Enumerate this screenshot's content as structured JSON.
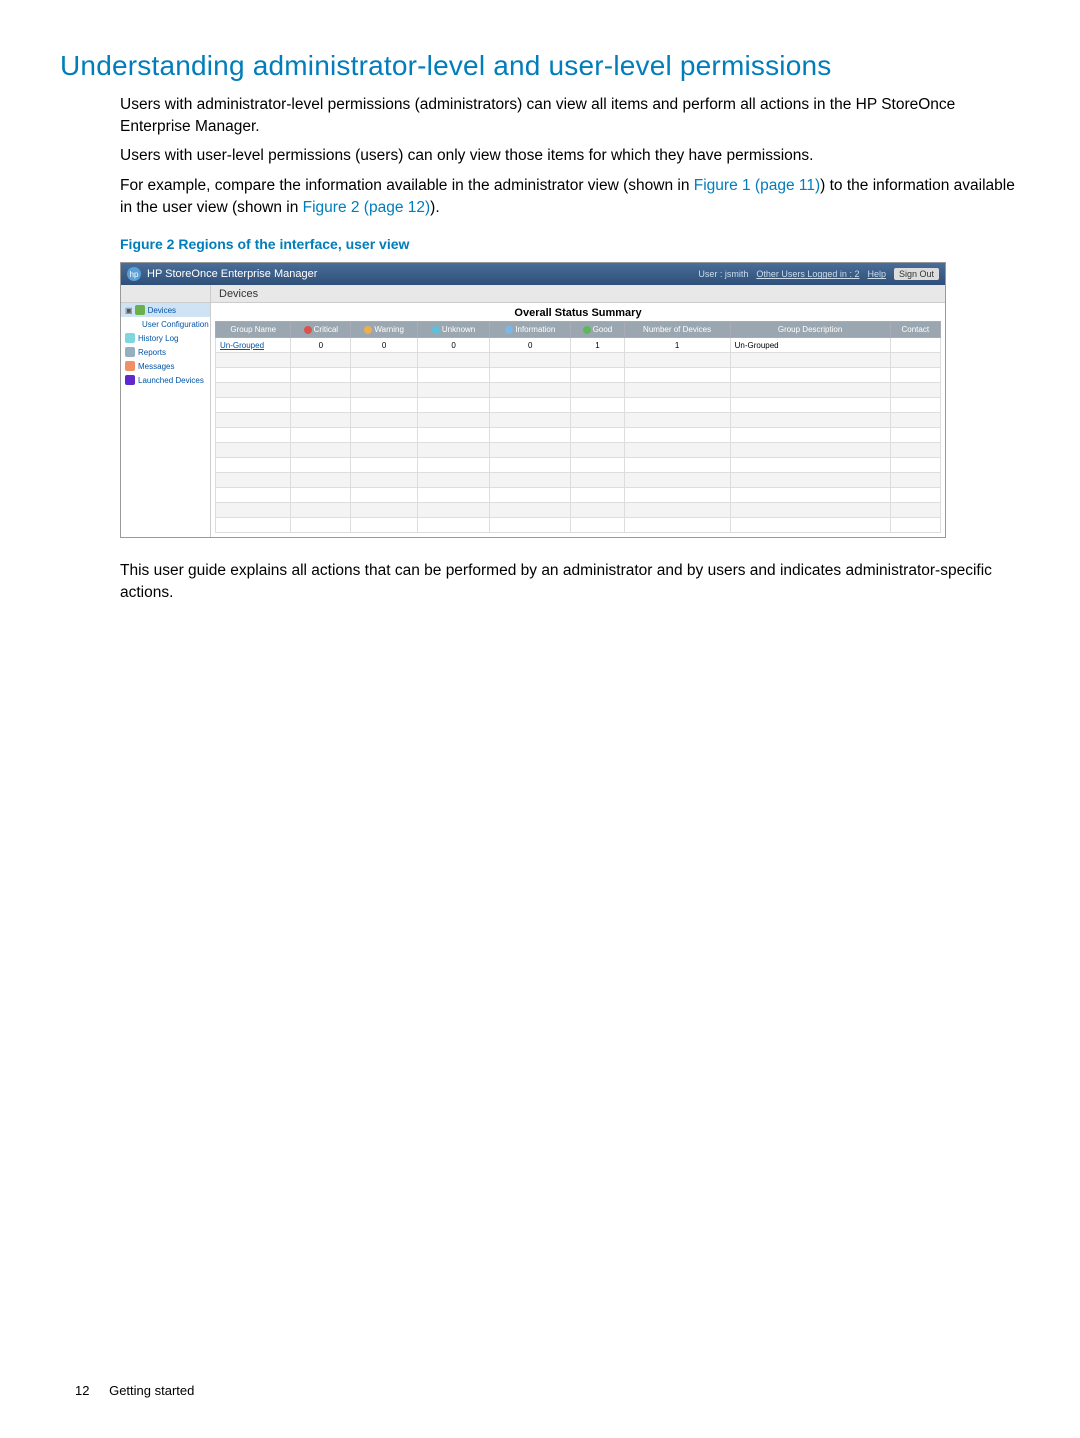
{
  "heading": "Understanding administrator-level and user-level permissions",
  "para1": "Users with administrator-level permissions (administrators) can view all items and perform all actions in the HP StoreOnce Enterprise Manager.",
  "para2": "Users with user-level permissions (users) can only view those items for which they have permissions.",
  "para3_a": "For example, compare the information available in the administrator view (shown in ",
  "para3_link1": "Figure 1 (page 11)",
  "para3_b": ") to the information available in the user view (shown in ",
  "para3_link2": "Figure 2 (page 12)",
  "para3_c": ").",
  "figure_caption": "Figure 2 Regions of the interface, user view",
  "app": {
    "title": "HP StoreOnce Enterprise Manager",
    "user_label": "User : jsmith",
    "other_users": "Other Users Logged in : 2",
    "help": "Help",
    "signout": "Sign Out",
    "crumb": "Devices",
    "summary_title": "Overall Status Summary",
    "sidebar": [
      {
        "label": "Devices",
        "selected": true
      },
      {
        "label": "User Configuration",
        "selected": false
      },
      {
        "label": "History Log",
        "selected": false
      },
      {
        "label": "Reports",
        "selected": false
      },
      {
        "label": "Messages",
        "selected": false
      },
      {
        "label": "Launched Devices",
        "selected": false
      }
    ],
    "columns": {
      "group_name": "Group Name",
      "critical": "Critical",
      "warning": "Warning",
      "unknown": "Unknown",
      "information": "Information",
      "good": "Good",
      "num_devices": "Number of Devices",
      "group_desc": "Group Description",
      "contact": "Contact"
    },
    "row": {
      "group_name": "Un-Grouped",
      "critical": "0",
      "warning": "0",
      "unknown": "0",
      "information": "0",
      "good": "1",
      "num_devices": "1",
      "group_desc": "Un-Grouped",
      "contact": ""
    }
  },
  "para4": "This user guide explains all actions that can be performed by an administrator and by users and indicates administrator-specific actions.",
  "footer": {
    "page_number": "12",
    "section": "Getting started"
  }
}
